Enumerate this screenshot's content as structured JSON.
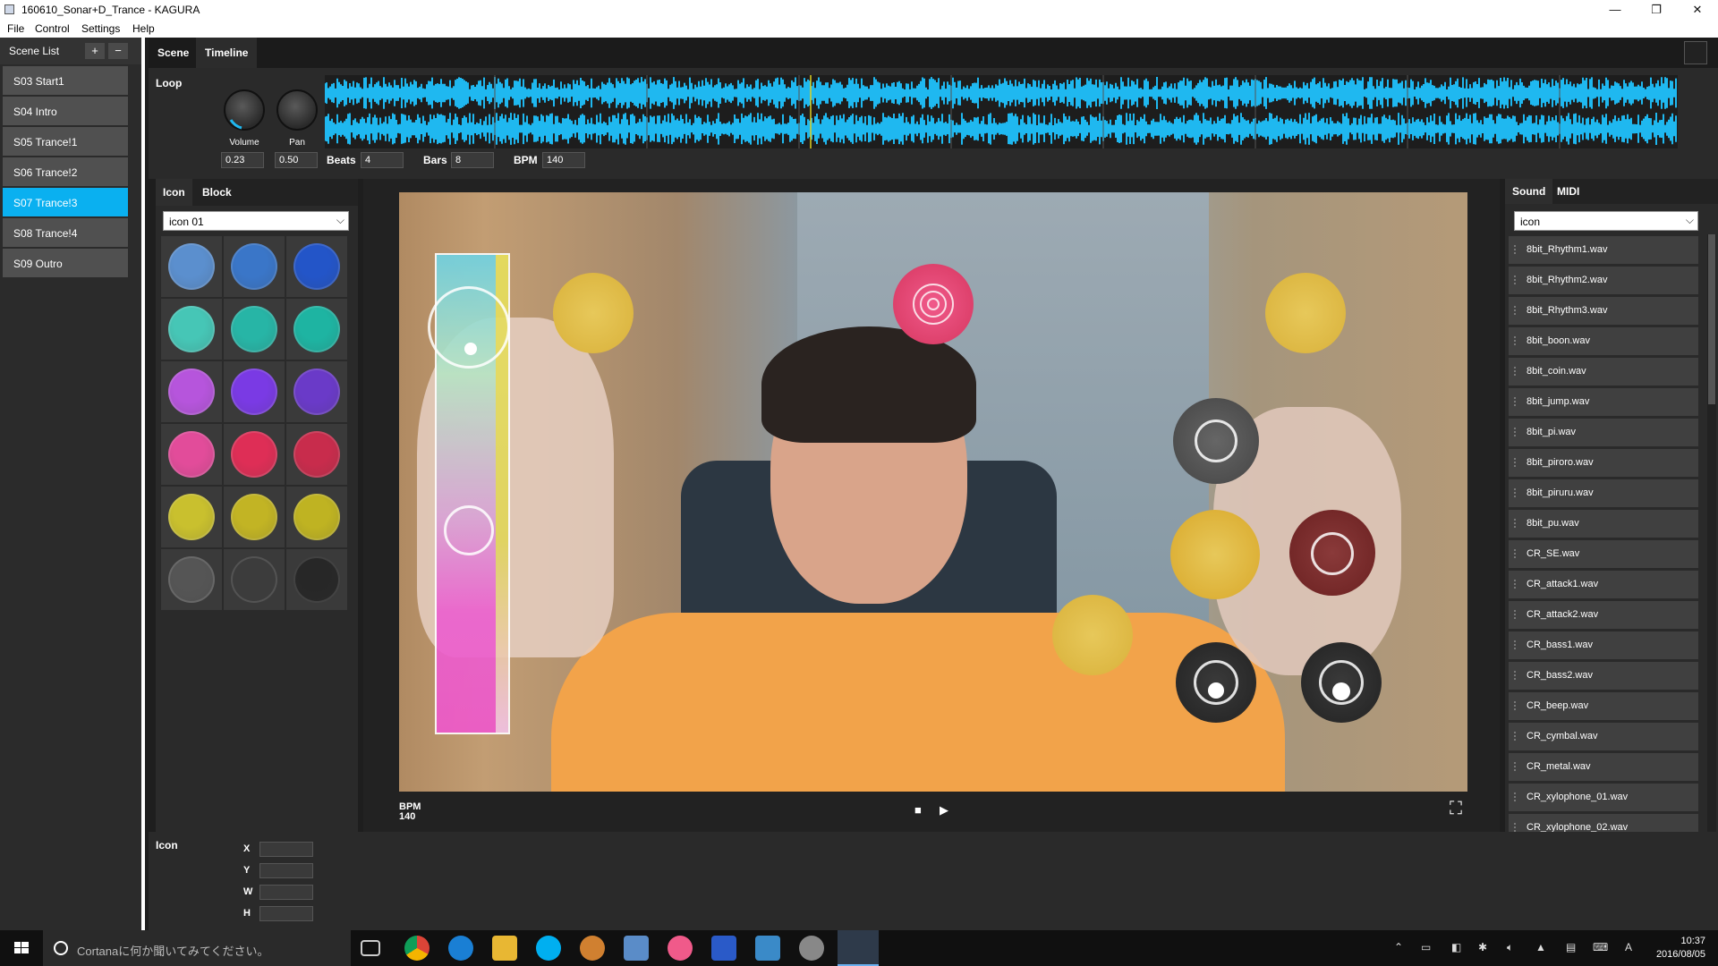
{
  "window": {
    "title": "160610_Sonar+D_Trance - KAGURA",
    "minimize": "—",
    "maximize": "❐",
    "close": "✕"
  },
  "menu": [
    "File",
    "Control",
    "Settings",
    "Help"
  ],
  "scene_list": {
    "title": "Scene List",
    "add": "+",
    "remove": "−",
    "items": [
      "S03 Start1",
      "S04 Intro",
      "S05 Trance!1",
      "S06 Trance!2",
      "S07 Trance!3",
      "S08 Trance!4",
      "S09 Outro"
    ],
    "selected": "S07 Trance!3"
  },
  "main_tabs": [
    "Scene",
    "Timeline"
  ],
  "loop": {
    "label": "Loop",
    "volume_label": "Volume",
    "pan_label": "Pan",
    "volume": "0.23",
    "pan": "0.50",
    "beats_label": "Beats",
    "beats": "4",
    "bars_label": "Bars",
    "bars": "8",
    "bpm_label": "BPM",
    "bpm": "140"
  },
  "icon_panel": {
    "tabs": [
      "Icon",
      "Block"
    ],
    "dropdown": "icon 01",
    "colors": [
      [
        "#5b8fce",
        "#3a76c8",
        "#2355c8"
      ],
      [
        "#46c6b6",
        "#27b5a6",
        "#1eb4a2"
      ],
      [
        "#b655dc",
        "#7a3ae4",
        "#6a3ac8"
      ],
      [
        "#e24c9a",
        "#de2e56",
        "#c82c4c"
      ],
      [
        "#c9c02e",
        "#c2b424",
        "#bfb322"
      ],
      [
        "#555555",
        "#3c3c3c",
        "#272727"
      ]
    ]
  },
  "properties": {
    "title": "Icon",
    "labels": [
      "X",
      "Y",
      "W",
      "H"
    ]
  },
  "stage": {
    "bpm_label": "BPM",
    "bpm": "140",
    "stop": "■",
    "play": "▶",
    "fullscreen": "⛶"
  },
  "sound_panel": {
    "tabs": [
      "Sound",
      "MIDI"
    ],
    "dropdown": "icon",
    "items": [
      "8bit_Rhythm1.wav",
      "8bit_Rhythm2.wav",
      "8bit_Rhythm3.wav",
      "8bit_boon.wav",
      "8bit_coin.wav",
      "8bit_jump.wav",
      "8bit_pi.wav",
      "8bit_piroro.wav",
      "8bit_piruru.wav",
      "8bit_pu.wav",
      "CR_SE.wav",
      "CR_attack1.wav",
      "CR_attack2.wav",
      "CR_bass1.wav",
      "CR_bass2.wav",
      "CR_beep.wav",
      "CR_cymbal.wav",
      "CR_metal.wav",
      "CR_xylophone_01.wav",
      "CR_xylophone_02.wav"
    ]
  },
  "taskbar": {
    "search_placeholder": "Cortanaに何か聞いてみてください。",
    "ime": "A",
    "time": "10:37",
    "date": "2016/08/05"
  },
  "colors": {
    "accent": "#0ab0f0",
    "waveform": "#1fb8f0",
    "playhead": "#e0d020"
  }
}
